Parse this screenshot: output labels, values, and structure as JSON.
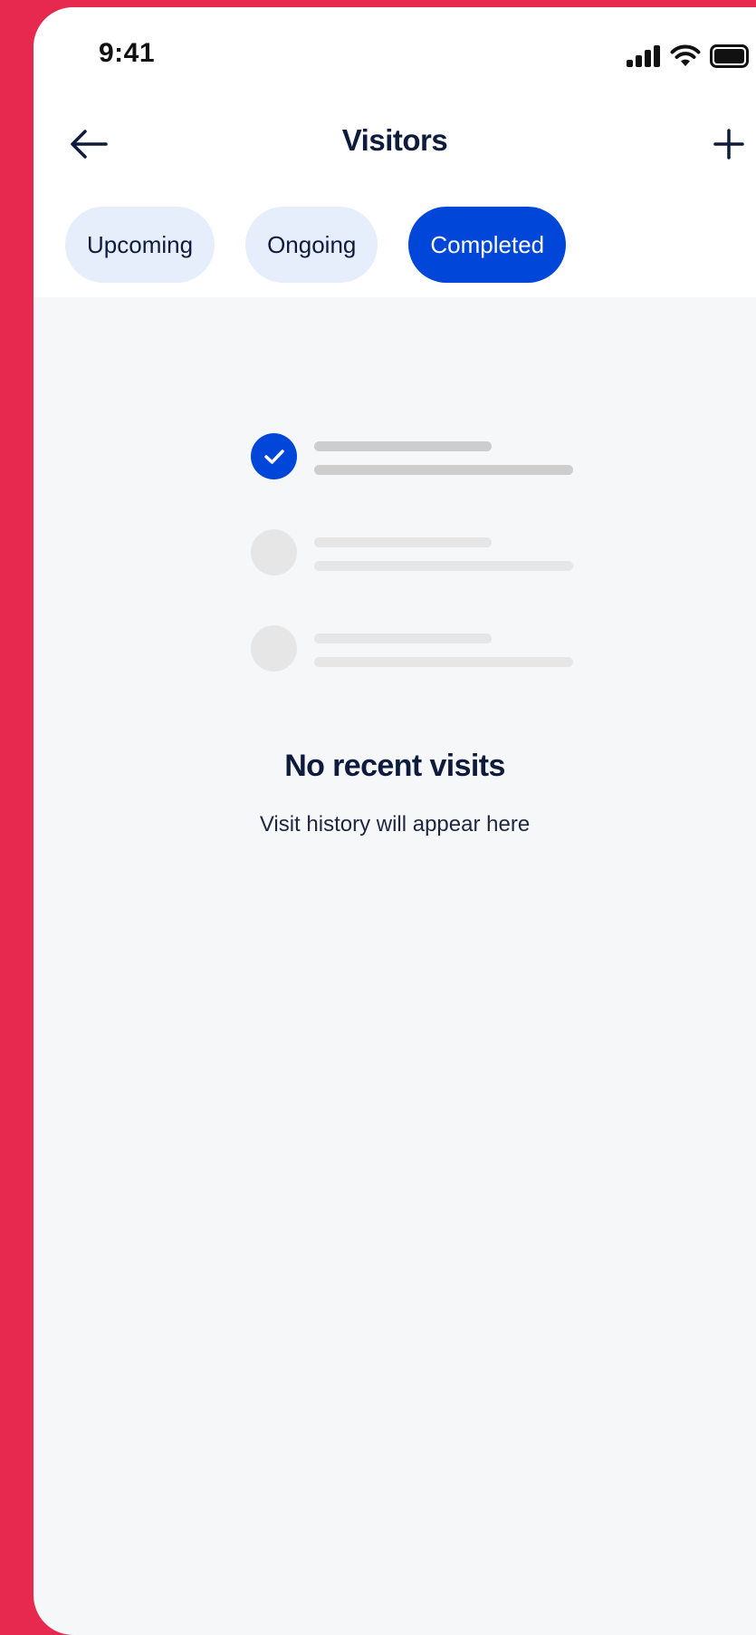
{
  "status_bar": {
    "time": "9:41",
    "icons": [
      "signal-icon",
      "wifi-icon",
      "battery-icon"
    ]
  },
  "header": {
    "back_icon": "arrow-left-icon",
    "title": "Visitors",
    "add_icon": "plus-icon"
  },
  "tabs": [
    {
      "label": "Upcoming",
      "active": false
    },
    {
      "label": "Ongoing",
      "active": false
    },
    {
      "label": "Completed",
      "active": true
    }
  ],
  "empty_state": {
    "illustration_icon": "checklist-placeholder-icon",
    "title": "No recent visits",
    "subtitle": "Visit history will appear here"
  },
  "colors": {
    "background_frame": "#E8294F",
    "accent": "#0047D9",
    "tab_inactive": "#E6EEFB",
    "text_primary": "#0E1B3D",
    "content_background": "#F6F7F8"
  }
}
